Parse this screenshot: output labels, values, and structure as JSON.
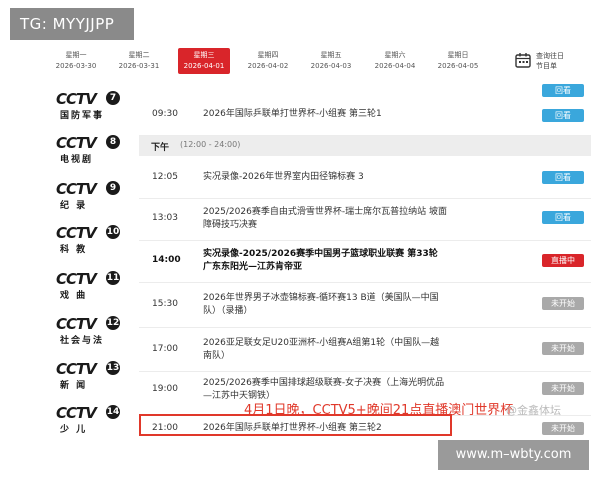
{
  "watermark_tag": "TG: MYYJJPP",
  "site_tag": "www.m–wbty.com",
  "days": [
    {
      "weekday": "星期一",
      "date": "2026-03-30",
      "active": false
    },
    {
      "weekday": "星期二",
      "date": "2026-03-31",
      "active": false
    },
    {
      "weekday": "星期三",
      "date": "2026-04-01",
      "active": true
    },
    {
      "weekday": "星期四",
      "date": "2026-04-02",
      "active": false
    },
    {
      "weekday": "星期五",
      "date": "2026-04-03",
      "active": false
    },
    {
      "weekday": "星期六",
      "date": "2026-04-04",
      "active": false
    },
    {
      "weekday": "星期日",
      "date": "2026-04-05",
      "active": false
    }
  ],
  "history": {
    "line1": "查询往日",
    "line2": "节目单",
    "icon": "calendar-icon"
  },
  "channels": [
    {
      "logo": "CCTV",
      "num": "7",
      "name": "国防军事"
    },
    {
      "logo": "CCTV",
      "num": "8",
      "name": "电视剧"
    },
    {
      "logo": "CCTV",
      "num": "9",
      "name": "纪 录"
    },
    {
      "logo": "CCTV",
      "num": "10",
      "name": "科 教"
    },
    {
      "logo": "CCTV",
      "num": "11",
      "name": "戏 曲"
    },
    {
      "logo": "CCTV",
      "num": "12",
      "name": "社会与法"
    },
    {
      "logo": "CCTV",
      "num": "13",
      "name": "新 闻"
    },
    {
      "logo": "CCTV",
      "num": "14",
      "name": "少 儿"
    }
  ],
  "section": {
    "label": "下午",
    "range": "(12:00 - 24:00)"
  },
  "programs": [
    {
      "time": "09:30",
      "title": "2026年国际乒联单打世界杯-小组赛 第三轮1",
      "status": "回看",
      "kind": "replay"
    },
    {
      "time": "12:05",
      "title": "实况录像-2026年世界室内田径锦标赛 3",
      "status": "回看",
      "kind": "replay"
    },
    {
      "time": "13:03",
      "title": "2025/2026赛季自由式滑雪世界杯-瑞士席尔瓦普拉纳站 坡面障碍技巧决赛",
      "status": "回看",
      "kind": "replay"
    },
    {
      "time": "14:00",
      "title": "实况录像-2025/2026赛季中国男子篮球职业联赛 第33轮 广东东阳光—江苏肯帝亚",
      "status": "直播中",
      "kind": "live"
    },
    {
      "time": "15:30",
      "title": "2026年世界男子冰壶锦标赛-循环赛13 B道（美国队—中国队）（录播）",
      "status": "未开始",
      "kind": "pending"
    },
    {
      "time": "17:00",
      "title": "2026亚足联女足U20亚洲杯-小组赛A组第1轮（中国队—越南队）",
      "status": "未开始",
      "kind": "pending"
    },
    {
      "time": "19:00",
      "title": "2025/2026赛季中国排球超级联赛-女子决赛（上海光明优品—江苏中天钢铁）",
      "status": "未开始",
      "kind": "pending"
    },
    {
      "time": "21:00",
      "title": "2026年国际乒联单打世界杯-小组赛 第三轮2",
      "status": "未开始",
      "kind": "pending"
    }
  ],
  "overlay_caption": "4月1日晚，CCTV5+晚间21点直播澳门世界杯",
  "weibo_mark": "@金鑫体坛",
  "colors": {
    "accent_red": "#d9252a",
    "replay_blue": "#3aa7dc",
    "pending_gray": "#a9a9a9"
  }
}
